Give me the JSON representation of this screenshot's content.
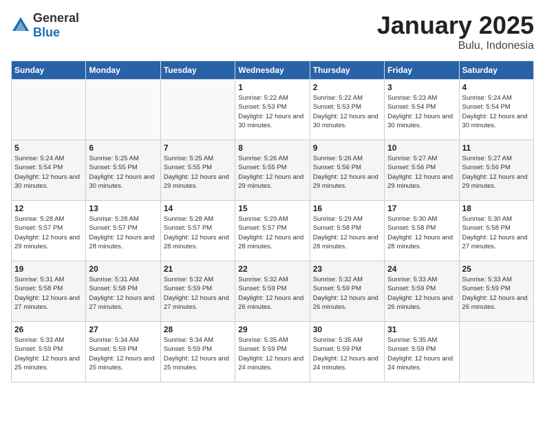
{
  "header": {
    "logo_general": "General",
    "logo_blue": "Blue",
    "title": "January 2025",
    "subtitle": "Bulu, Indonesia"
  },
  "days_of_week": [
    "Sunday",
    "Monday",
    "Tuesday",
    "Wednesday",
    "Thursday",
    "Friday",
    "Saturday"
  ],
  "weeks": [
    [
      {
        "day": "",
        "info": ""
      },
      {
        "day": "",
        "info": ""
      },
      {
        "day": "",
        "info": ""
      },
      {
        "day": "1",
        "info": "Sunrise: 5:22 AM\nSunset: 5:53 PM\nDaylight: 12 hours\nand 30 minutes."
      },
      {
        "day": "2",
        "info": "Sunrise: 5:22 AM\nSunset: 5:53 PM\nDaylight: 12 hours\nand 30 minutes."
      },
      {
        "day": "3",
        "info": "Sunrise: 5:23 AM\nSunset: 5:54 PM\nDaylight: 12 hours\nand 30 minutes."
      },
      {
        "day": "4",
        "info": "Sunrise: 5:24 AM\nSunset: 5:54 PM\nDaylight: 12 hours\nand 30 minutes."
      }
    ],
    [
      {
        "day": "5",
        "info": "Sunrise: 5:24 AM\nSunset: 5:54 PM\nDaylight: 12 hours\nand 30 minutes."
      },
      {
        "day": "6",
        "info": "Sunrise: 5:25 AM\nSunset: 5:55 PM\nDaylight: 12 hours\nand 30 minutes."
      },
      {
        "day": "7",
        "info": "Sunrise: 5:25 AM\nSunset: 5:55 PM\nDaylight: 12 hours\nand 29 minutes."
      },
      {
        "day": "8",
        "info": "Sunrise: 5:26 AM\nSunset: 5:55 PM\nDaylight: 12 hours\nand 29 minutes."
      },
      {
        "day": "9",
        "info": "Sunrise: 5:26 AM\nSunset: 5:56 PM\nDaylight: 12 hours\nand 29 minutes."
      },
      {
        "day": "10",
        "info": "Sunrise: 5:27 AM\nSunset: 5:56 PM\nDaylight: 12 hours\nand 29 minutes."
      },
      {
        "day": "11",
        "info": "Sunrise: 5:27 AM\nSunset: 5:56 PM\nDaylight: 12 hours\nand 29 minutes."
      }
    ],
    [
      {
        "day": "12",
        "info": "Sunrise: 5:28 AM\nSunset: 5:57 PM\nDaylight: 12 hours\nand 29 minutes."
      },
      {
        "day": "13",
        "info": "Sunrise: 5:28 AM\nSunset: 5:57 PM\nDaylight: 12 hours\nand 28 minutes."
      },
      {
        "day": "14",
        "info": "Sunrise: 5:28 AM\nSunset: 5:57 PM\nDaylight: 12 hours\nand 28 minutes."
      },
      {
        "day": "15",
        "info": "Sunrise: 5:29 AM\nSunset: 5:57 PM\nDaylight: 12 hours\nand 28 minutes."
      },
      {
        "day": "16",
        "info": "Sunrise: 5:29 AM\nSunset: 5:58 PM\nDaylight: 12 hours\nand 28 minutes."
      },
      {
        "day": "17",
        "info": "Sunrise: 5:30 AM\nSunset: 5:58 PM\nDaylight: 12 hours\nand 28 minutes."
      },
      {
        "day": "18",
        "info": "Sunrise: 5:30 AM\nSunset: 5:58 PM\nDaylight: 12 hours\nand 27 minutes."
      }
    ],
    [
      {
        "day": "19",
        "info": "Sunrise: 5:31 AM\nSunset: 5:58 PM\nDaylight: 12 hours\nand 27 minutes."
      },
      {
        "day": "20",
        "info": "Sunrise: 5:31 AM\nSunset: 5:58 PM\nDaylight: 12 hours\nand 27 minutes."
      },
      {
        "day": "21",
        "info": "Sunrise: 5:32 AM\nSunset: 5:59 PM\nDaylight: 12 hours\nand 27 minutes."
      },
      {
        "day": "22",
        "info": "Sunrise: 5:32 AM\nSunset: 5:59 PM\nDaylight: 12 hours\nand 26 minutes."
      },
      {
        "day": "23",
        "info": "Sunrise: 5:32 AM\nSunset: 5:59 PM\nDaylight: 12 hours\nand 26 minutes."
      },
      {
        "day": "24",
        "info": "Sunrise: 5:33 AM\nSunset: 5:59 PM\nDaylight: 12 hours\nand 26 minutes."
      },
      {
        "day": "25",
        "info": "Sunrise: 5:33 AM\nSunset: 5:59 PM\nDaylight: 12 hours\nand 26 minutes."
      }
    ],
    [
      {
        "day": "26",
        "info": "Sunrise: 5:33 AM\nSunset: 5:59 PM\nDaylight: 12 hours\nand 25 minutes."
      },
      {
        "day": "27",
        "info": "Sunrise: 5:34 AM\nSunset: 5:59 PM\nDaylight: 12 hours\nand 25 minutes."
      },
      {
        "day": "28",
        "info": "Sunrise: 5:34 AM\nSunset: 5:59 PM\nDaylight: 12 hours\nand 25 minutes."
      },
      {
        "day": "29",
        "info": "Sunrise: 5:35 AM\nSunset: 5:59 PM\nDaylight: 12 hours\nand 24 minutes."
      },
      {
        "day": "30",
        "info": "Sunrise: 5:35 AM\nSunset: 5:59 PM\nDaylight: 12 hours\nand 24 minutes."
      },
      {
        "day": "31",
        "info": "Sunrise: 5:35 AM\nSunset: 5:59 PM\nDaylight: 12 hours\nand 24 minutes."
      },
      {
        "day": "",
        "info": ""
      }
    ]
  ]
}
